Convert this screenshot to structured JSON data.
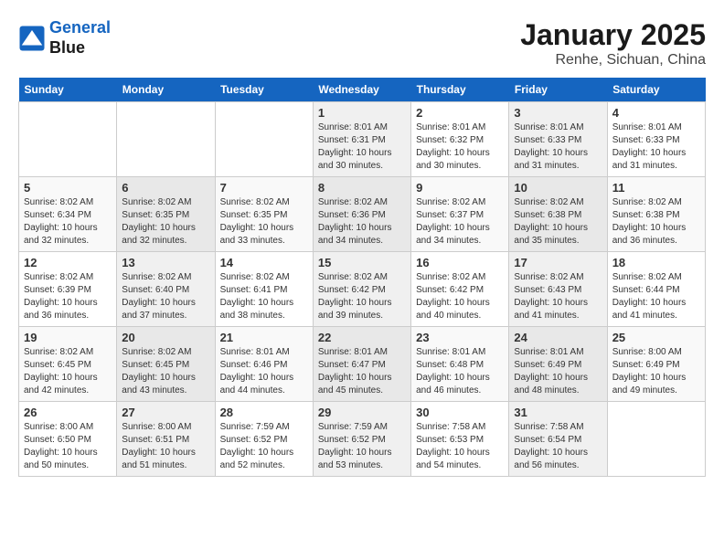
{
  "header": {
    "logo_line1": "General",
    "logo_line2": "Blue",
    "month": "January 2025",
    "location": "Renhe, Sichuan, China"
  },
  "days_of_week": [
    "Sunday",
    "Monday",
    "Tuesday",
    "Wednesday",
    "Thursday",
    "Friday",
    "Saturday"
  ],
  "weeks": [
    [
      {
        "num": "",
        "info": ""
      },
      {
        "num": "",
        "info": ""
      },
      {
        "num": "",
        "info": ""
      },
      {
        "num": "1",
        "info": "Sunrise: 8:01 AM\nSunset: 6:31 PM\nDaylight: 10 hours\nand 30 minutes."
      },
      {
        "num": "2",
        "info": "Sunrise: 8:01 AM\nSunset: 6:32 PM\nDaylight: 10 hours\nand 30 minutes."
      },
      {
        "num": "3",
        "info": "Sunrise: 8:01 AM\nSunset: 6:33 PM\nDaylight: 10 hours\nand 31 minutes."
      },
      {
        "num": "4",
        "info": "Sunrise: 8:01 AM\nSunset: 6:33 PM\nDaylight: 10 hours\nand 31 minutes."
      }
    ],
    [
      {
        "num": "5",
        "info": "Sunrise: 8:02 AM\nSunset: 6:34 PM\nDaylight: 10 hours\nand 32 minutes."
      },
      {
        "num": "6",
        "info": "Sunrise: 8:02 AM\nSunset: 6:35 PM\nDaylight: 10 hours\nand 32 minutes."
      },
      {
        "num": "7",
        "info": "Sunrise: 8:02 AM\nSunset: 6:35 PM\nDaylight: 10 hours\nand 33 minutes."
      },
      {
        "num": "8",
        "info": "Sunrise: 8:02 AM\nSunset: 6:36 PM\nDaylight: 10 hours\nand 34 minutes."
      },
      {
        "num": "9",
        "info": "Sunrise: 8:02 AM\nSunset: 6:37 PM\nDaylight: 10 hours\nand 34 minutes."
      },
      {
        "num": "10",
        "info": "Sunrise: 8:02 AM\nSunset: 6:38 PM\nDaylight: 10 hours\nand 35 minutes."
      },
      {
        "num": "11",
        "info": "Sunrise: 8:02 AM\nSunset: 6:38 PM\nDaylight: 10 hours\nand 36 minutes."
      }
    ],
    [
      {
        "num": "12",
        "info": "Sunrise: 8:02 AM\nSunset: 6:39 PM\nDaylight: 10 hours\nand 36 minutes."
      },
      {
        "num": "13",
        "info": "Sunrise: 8:02 AM\nSunset: 6:40 PM\nDaylight: 10 hours\nand 37 minutes."
      },
      {
        "num": "14",
        "info": "Sunrise: 8:02 AM\nSunset: 6:41 PM\nDaylight: 10 hours\nand 38 minutes."
      },
      {
        "num": "15",
        "info": "Sunrise: 8:02 AM\nSunset: 6:42 PM\nDaylight: 10 hours\nand 39 minutes."
      },
      {
        "num": "16",
        "info": "Sunrise: 8:02 AM\nSunset: 6:42 PM\nDaylight: 10 hours\nand 40 minutes."
      },
      {
        "num": "17",
        "info": "Sunrise: 8:02 AM\nSunset: 6:43 PM\nDaylight: 10 hours\nand 41 minutes."
      },
      {
        "num": "18",
        "info": "Sunrise: 8:02 AM\nSunset: 6:44 PM\nDaylight: 10 hours\nand 41 minutes."
      }
    ],
    [
      {
        "num": "19",
        "info": "Sunrise: 8:02 AM\nSunset: 6:45 PM\nDaylight: 10 hours\nand 42 minutes."
      },
      {
        "num": "20",
        "info": "Sunrise: 8:02 AM\nSunset: 6:45 PM\nDaylight: 10 hours\nand 43 minutes."
      },
      {
        "num": "21",
        "info": "Sunrise: 8:01 AM\nSunset: 6:46 PM\nDaylight: 10 hours\nand 44 minutes."
      },
      {
        "num": "22",
        "info": "Sunrise: 8:01 AM\nSunset: 6:47 PM\nDaylight: 10 hours\nand 45 minutes."
      },
      {
        "num": "23",
        "info": "Sunrise: 8:01 AM\nSunset: 6:48 PM\nDaylight: 10 hours\nand 46 minutes."
      },
      {
        "num": "24",
        "info": "Sunrise: 8:01 AM\nSunset: 6:49 PM\nDaylight: 10 hours\nand 48 minutes."
      },
      {
        "num": "25",
        "info": "Sunrise: 8:00 AM\nSunset: 6:49 PM\nDaylight: 10 hours\nand 49 minutes."
      }
    ],
    [
      {
        "num": "26",
        "info": "Sunrise: 8:00 AM\nSunset: 6:50 PM\nDaylight: 10 hours\nand 50 minutes."
      },
      {
        "num": "27",
        "info": "Sunrise: 8:00 AM\nSunset: 6:51 PM\nDaylight: 10 hours\nand 51 minutes."
      },
      {
        "num": "28",
        "info": "Sunrise: 7:59 AM\nSunset: 6:52 PM\nDaylight: 10 hours\nand 52 minutes."
      },
      {
        "num": "29",
        "info": "Sunrise: 7:59 AM\nSunset: 6:52 PM\nDaylight: 10 hours\nand 53 minutes."
      },
      {
        "num": "30",
        "info": "Sunrise: 7:58 AM\nSunset: 6:53 PM\nDaylight: 10 hours\nand 54 minutes."
      },
      {
        "num": "31",
        "info": "Sunrise: 7:58 AM\nSunset: 6:54 PM\nDaylight: 10 hours\nand 56 minutes."
      },
      {
        "num": "",
        "info": ""
      }
    ]
  ]
}
